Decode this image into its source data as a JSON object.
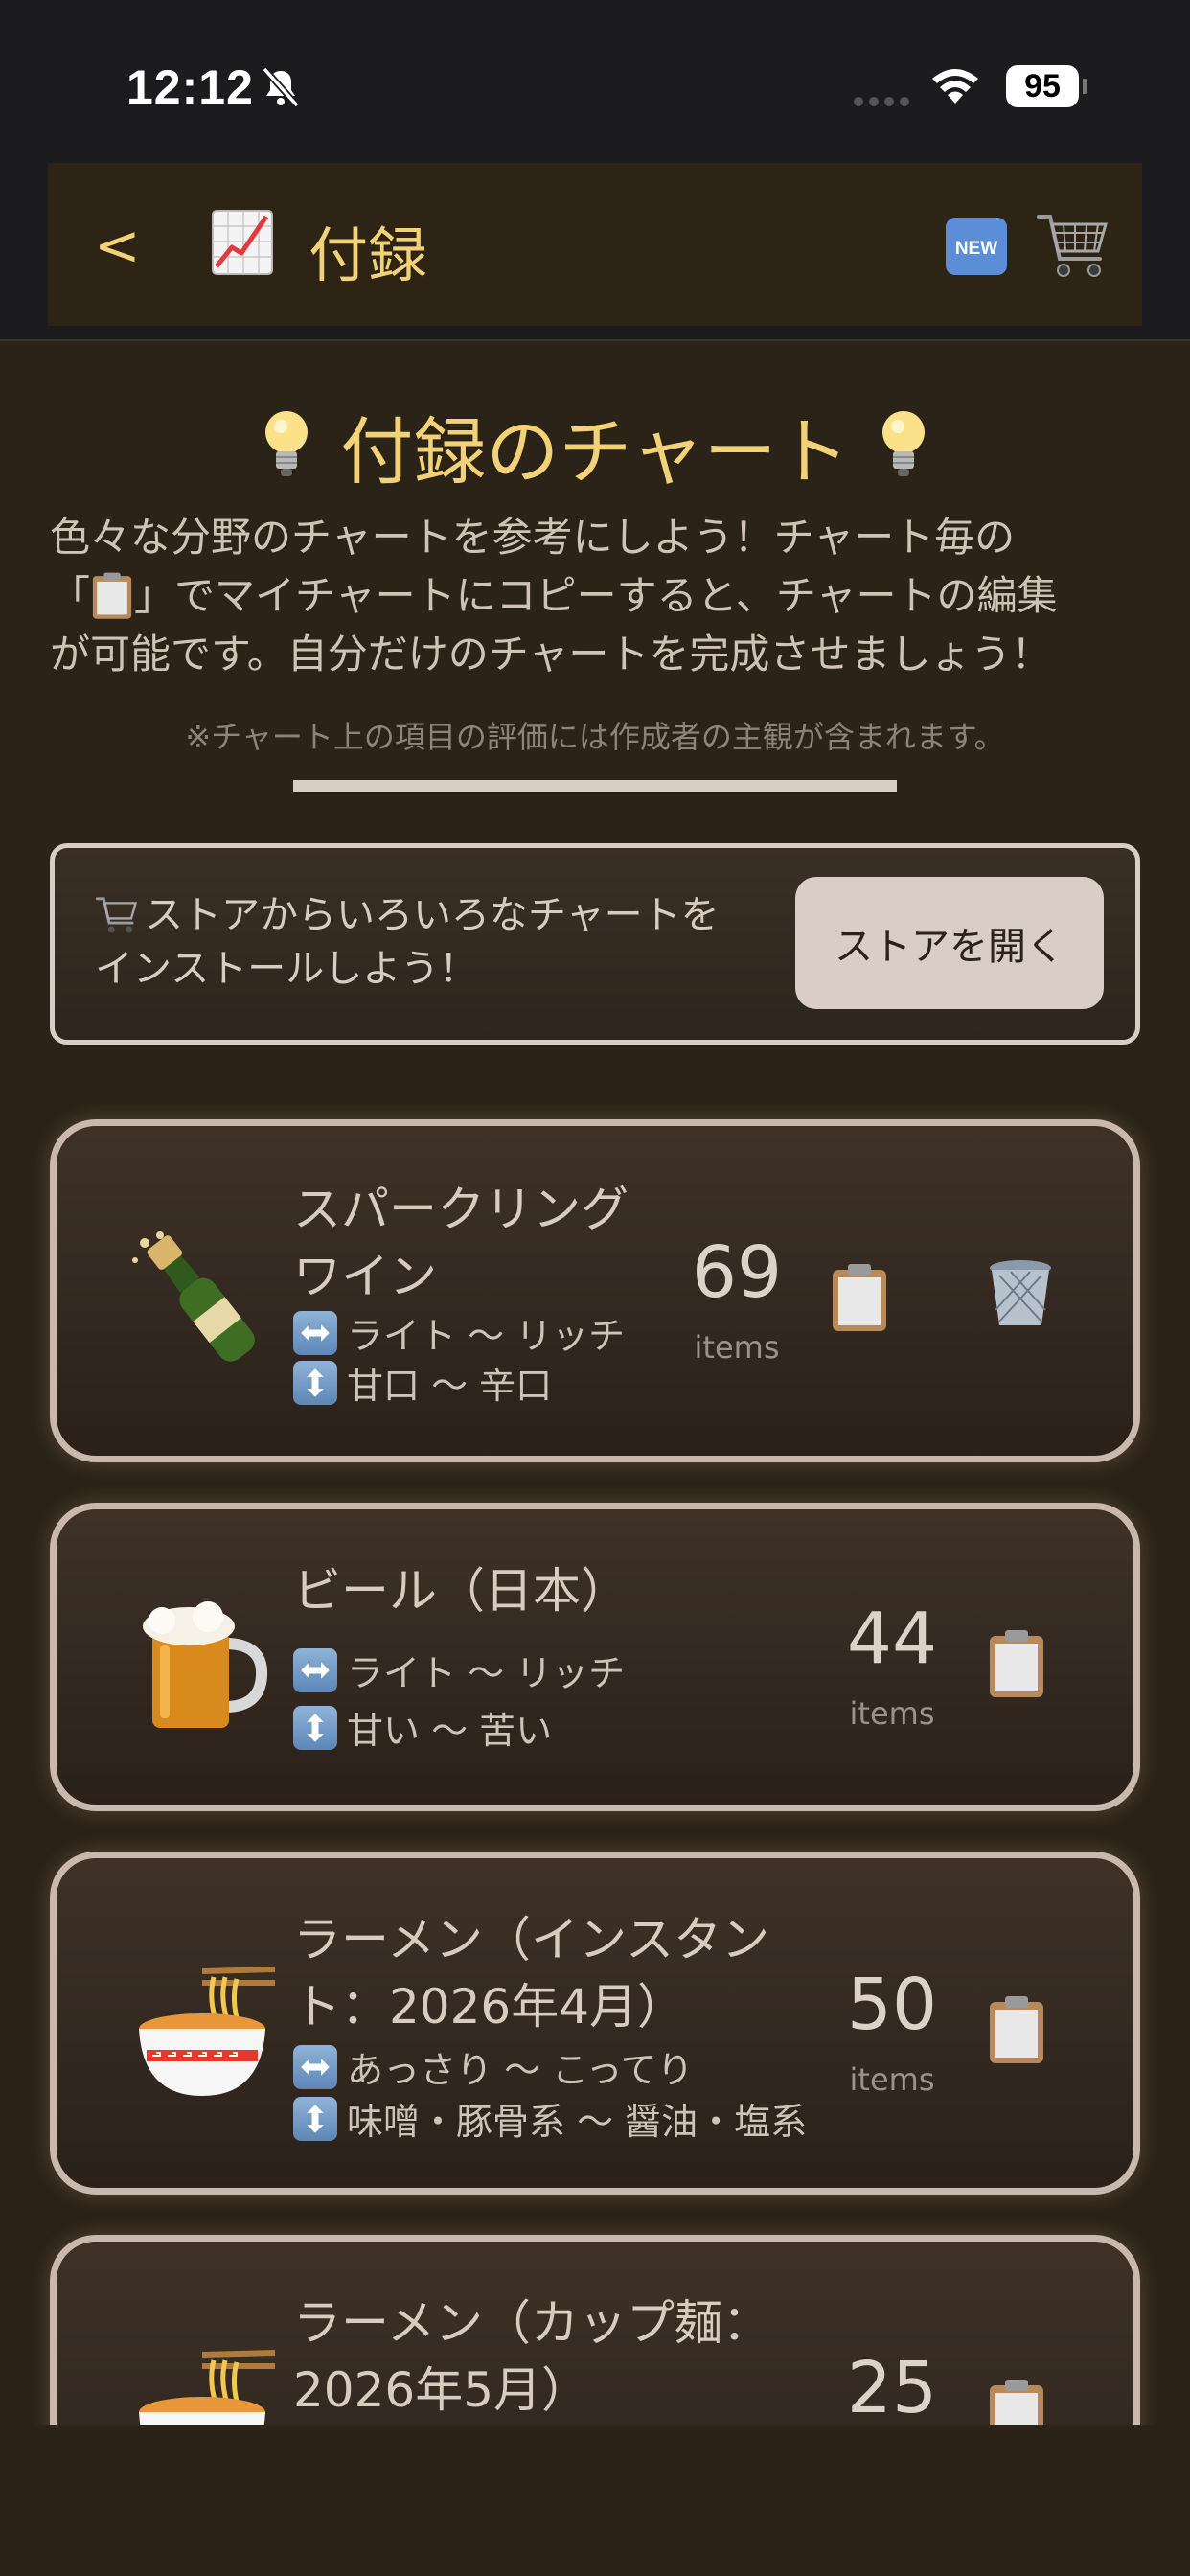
{
  "status": {
    "time": "12:12",
    "battery": "95"
  },
  "nav": {
    "back": "<",
    "title": "付録",
    "chart_icon": "chart-increasing-icon",
    "new_icon": "new-badge-icon",
    "cart_icon": "cart-icon"
  },
  "header": {
    "title": "付録のチャート",
    "intro_1": "色々な分野のチャートを参考にしよう！チャート毎の",
    "intro_2a": "「",
    "intro_2b": "」でマイチャートにコピーすると、チャートの編集",
    "intro_3": "が可能です。自分だけのチャートを完成させましょう！",
    "note": "※チャート上の項目の評価には作成者の主観が含まれます。"
  },
  "store": {
    "text_1": "ストアからいろいろなチャートを",
    "text_2": "インストールしよう！",
    "button": "ストアを開く"
  },
  "cards": [
    {
      "icon": "champagne-bottle-icon",
      "title_1": "スパークリング",
      "title_2": "ワイン",
      "axis_h": "ライト 〜 リッチ",
      "axis_v": "甘口 〜 辛口",
      "count": "69",
      "unit": "items"
    },
    {
      "icon": "beer-mug-icon",
      "title_1": "ビール（日本）",
      "axis_h": "ライト 〜 リッチ",
      "axis_v": "甘い 〜 苦い",
      "count": "44",
      "unit": "items"
    },
    {
      "icon": "ramen-bowl-icon",
      "title_1": "ラーメン（インスタン",
      "title_2": "ト：2026年4月）",
      "axis_h": "あっさり 〜 こってり",
      "axis_v": "味噌・豚骨系 〜 醤油・塩系",
      "count": "50",
      "unit": "items"
    },
    {
      "icon": "ramen-bowl-icon",
      "title_1": "ラーメン（カップ麺：",
      "title_2": "2026年5月）",
      "count": "25"
    }
  ]
}
